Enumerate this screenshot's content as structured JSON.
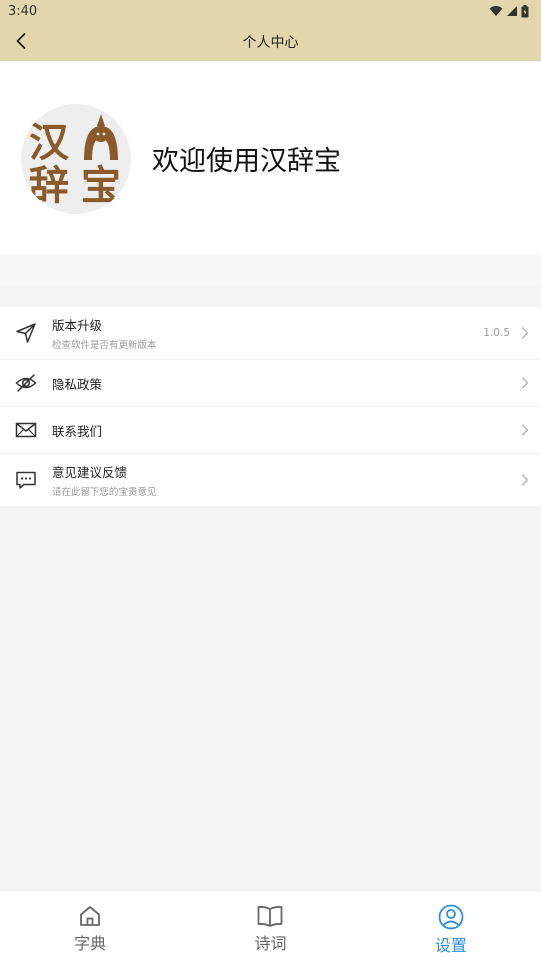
{
  "status_bar": {
    "time": "3:40"
  },
  "app_bar": {
    "title": "个人中心"
  },
  "profile": {
    "logo_text": [
      "汉",
      "辞",
      "宝"
    ],
    "welcome": "欢迎使用汉辞宝"
  },
  "menu": {
    "items": [
      {
        "title": "版本升级",
        "subtitle": "检查软件是否有更新版本",
        "value": "1.0.5",
        "icon": "send-icon"
      },
      {
        "title": "隐私政策",
        "subtitle": "",
        "value": "",
        "icon": "eye-off-icon"
      },
      {
        "title": "联系我们",
        "subtitle": "",
        "value": "",
        "icon": "mail-icon"
      },
      {
        "title": "意见建议反馈",
        "subtitle": "请在此留下您的宝贵意见",
        "value": "",
        "icon": "chat-icon"
      }
    ]
  },
  "tabs": [
    {
      "label": "字典",
      "icon": "home-icon",
      "active": false
    },
    {
      "label": "诗词",
      "icon": "book-icon",
      "active": false
    },
    {
      "label": "设置",
      "icon": "user-circle-icon",
      "active": true
    }
  ],
  "colors": {
    "header_bg": "#e2d6ac",
    "accent": "#2d8fe6",
    "logo_brown": "#8a5a2b"
  }
}
